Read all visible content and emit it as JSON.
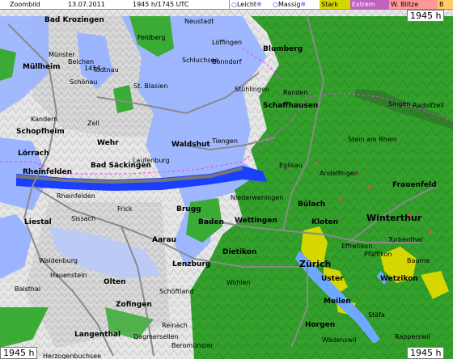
{
  "header": {
    "title": "Zoombild",
    "date": "13.07.2011",
    "time": "1945 h/1745 UTC"
  },
  "legend": [
    {
      "label": "Leicht",
      "color": "#9ab4ff"
    },
    {
      "label": "Massig",
      "color": "#bfe8ff"
    },
    {
      "label": "Stark",
      "color": "#d6d600"
    },
    {
      "label": "Extrem",
      "color": "#c060c0"
    },
    {
      "label": "W. Blitze",
      "color": "#ff9999"
    },
    {
      "label": "B",
      "color": "#ffcc66"
    }
  ],
  "timestamps": {
    "top_right": "1945 h",
    "bottom_left": "1945 h",
    "bottom_right": "1945 h"
  },
  "places": [
    {
      "name": "Bad Krozingen",
      "style": "b"
    },
    {
      "name": "Neustadt",
      "style": ""
    },
    {
      "name": "Feldberg",
      "style": ""
    },
    {
      "name": "Löffingen",
      "style": ""
    },
    {
      "name": "Blumberg",
      "style": "b"
    },
    {
      "name": "Münster",
      "style": ""
    },
    {
      "name": "Belchen",
      "style": ""
    },
    {
      "name": "1414",
      "style": ""
    },
    {
      "name": "Todtnau",
      "style": ""
    },
    {
      "name": "Schluchsee",
      "style": ""
    },
    {
      "name": "Bonndorf",
      "style": ""
    },
    {
      "name": "Müllheim",
      "style": "b"
    },
    {
      "name": "Schönau",
      "style": ""
    },
    {
      "name": "St. Blasien",
      "style": ""
    },
    {
      "name": "Stühlingen",
      "style": ""
    },
    {
      "name": "Randen",
      "style": ""
    },
    {
      "name": "Schaffhausen",
      "style": "b"
    },
    {
      "name": "Singen",
      "style": ""
    },
    {
      "name": "Radolfzell",
      "style": ""
    },
    {
      "name": "Kandern",
      "style": ""
    },
    {
      "name": "Zell",
      "style": ""
    },
    {
      "name": "Schopfheim",
      "style": "b"
    },
    {
      "name": "Wehr",
      "style": "b"
    },
    {
      "name": "Waldshut",
      "style": "b"
    },
    {
      "name": "Tiengen",
      "style": ""
    },
    {
      "name": "Stein am Rhein",
      "style": ""
    },
    {
      "name": "Lörrach",
      "style": "b"
    },
    {
      "name": "Bad Säckingen",
      "style": "b"
    },
    {
      "name": "Laufenburg",
      "style": ""
    },
    {
      "name": "Eglisau",
      "style": ""
    },
    {
      "name": "Andelfingen",
      "style": ""
    },
    {
      "name": "Frauenfeld",
      "style": "b"
    },
    {
      "name": "Rheinfelden",
      "style": "b"
    },
    {
      "name": "Rheinfelden",
      "style": ""
    },
    {
      "name": "Bülach",
      "style": "b"
    },
    {
      "name": "Winterthur",
      "style": "lg"
    },
    {
      "name": "Niederweningen",
      "style": ""
    },
    {
      "name": "Liestal",
      "style": "b"
    },
    {
      "name": "Sissach",
      "style": ""
    },
    {
      "name": "Frick",
      "style": ""
    },
    {
      "name": "Brugg",
      "style": "b"
    },
    {
      "name": "Baden",
      "style": "b"
    },
    {
      "name": "Wettingen",
      "style": "b"
    },
    {
      "name": "Kloten",
      "style": "b"
    },
    {
      "name": "Effretikon",
      "style": ""
    },
    {
      "name": "Turbenthal",
      "style": ""
    },
    {
      "name": "Aarau",
      "style": "b"
    },
    {
      "name": "Waldenburg",
      "style": ""
    },
    {
      "name": "Hauenstein",
      "style": ""
    },
    {
      "name": "Balsthal",
      "style": ""
    },
    {
      "name": "Olten",
      "style": "b"
    },
    {
      "name": "Lenzburg",
      "style": "b"
    },
    {
      "name": "Dietikon",
      "style": "b"
    },
    {
      "name": "Zürich",
      "style": "lg"
    },
    {
      "name": "Pfäffikon",
      "style": ""
    },
    {
      "name": "Bauma",
      "style": ""
    },
    {
      "name": "Uster",
      "style": "b"
    },
    {
      "name": "Wetzikon",
      "style": "b"
    },
    {
      "name": "Wohlen",
      "style": ""
    },
    {
      "name": "Zofingen",
      "style": "b"
    },
    {
      "name": "Schöftland",
      "style": ""
    },
    {
      "name": "Langenthal",
      "style": "b"
    },
    {
      "name": "Reinach",
      "style": ""
    },
    {
      "name": "Meilen",
      "style": "b"
    },
    {
      "name": "Horgen",
      "style": "b"
    },
    {
      "name": "Stäfa",
      "style": ""
    },
    {
      "name": "Rapperswil",
      "style": ""
    },
    {
      "name": "Wädenswil",
      "style": ""
    },
    {
      "name": "Herzogenbuchsee",
      "style": ""
    },
    {
      "name": "Dagmersellen",
      "style": ""
    },
    {
      "name": "Beromünster",
      "style": ""
    }
  ]
}
